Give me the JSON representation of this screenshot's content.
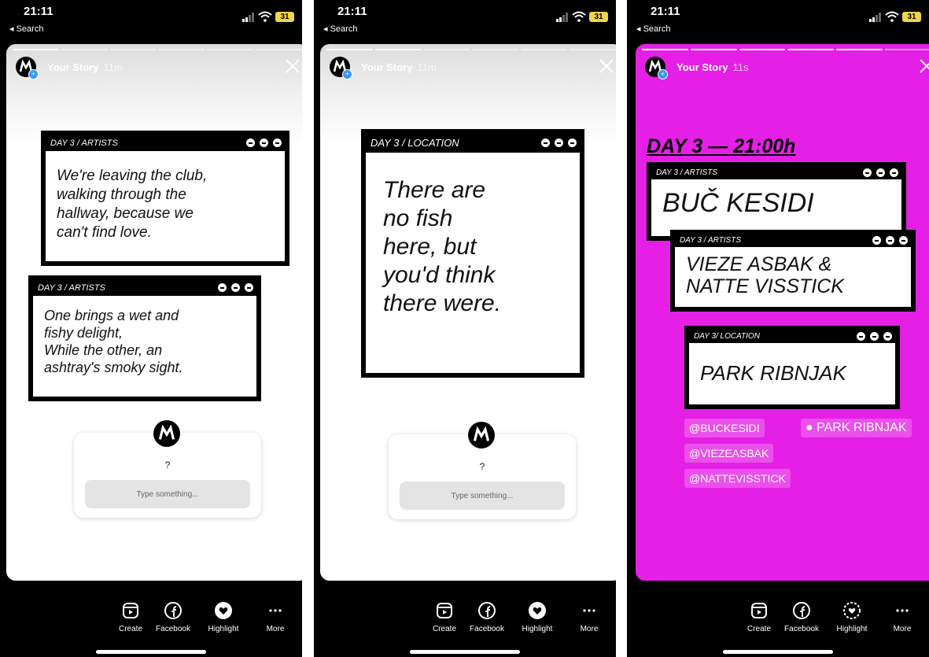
{
  "status": {
    "time": "21:11",
    "back_label": "◂ Search",
    "battery": "31"
  },
  "story": {
    "title": "Your Story"
  },
  "screens": [
    {
      "age": "11m",
      "windows": [
        {
          "header": "DAY 3 / ARTISTS",
          "body": "We're leaving the club,\nwalking through the\nhallway, because we\ncan't find love."
        },
        {
          "header": "DAY 3 / ARTISTS",
          "body": "One brings a wet and\nfishy delight,\nWhile the other, an\nashtray's smoky sight."
        }
      ],
      "question": {
        "prompt": "?",
        "placeholder": "Type something..."
      }
    },
    {
      "age": "11m",
      "windows": [
        {
          "header": "DAY 3 / LOCATION",
          "body": "There are\nno fish\nhere, but\nyou'd think\nthere were."
        }
      ],
      "question": {
        "prompt": "?",
        "placeholder": "Type something..."
      }
    },
    {
      "age": "11s",
      "heading": "DAY 3 — 21:00h",
      "windows": [
        {
          "header": "DAY 3 / ARTISTS",
          "body": "BUČ KESIDI"
        },
        {
          "header": "DAY 3 / ARTISTS",
          "body": "VIEZE ASBAK &\nNATTE VISSTICK"
        },
        {
          "header": "DAY 3/ LOCATION",
          "body": "PARK RIBNJAK"
        }
      ],
      "mentions": [
        "@BUCKESIDI",
        "@VIEZEASBAK",
        "@NATTEVISSTICK"
      ],
      "location": "PARK RIBNJAK"
    }
  ],
  "actions": {
    "create": "Create",
    "facebook": "Facebook",
    "highlight": "Highlight",
    "more": "More"
  },
  "colors": {
    "story_pink": "#e51fe6",
    "battery": "#f2d44a",
    "badge_blue": "#3897f0"
  },
  "icons": [
    "signal-icon",
    "wifi-icon",
    "battery-icon",
    "avatar-logo-icon",
    "close-icon",
    "create-icon",
    "facebook-icon",
    "highlight-icon",
    "more-icon",
    "location-pin-icon",
    "window-control-icon"
  ]
}
